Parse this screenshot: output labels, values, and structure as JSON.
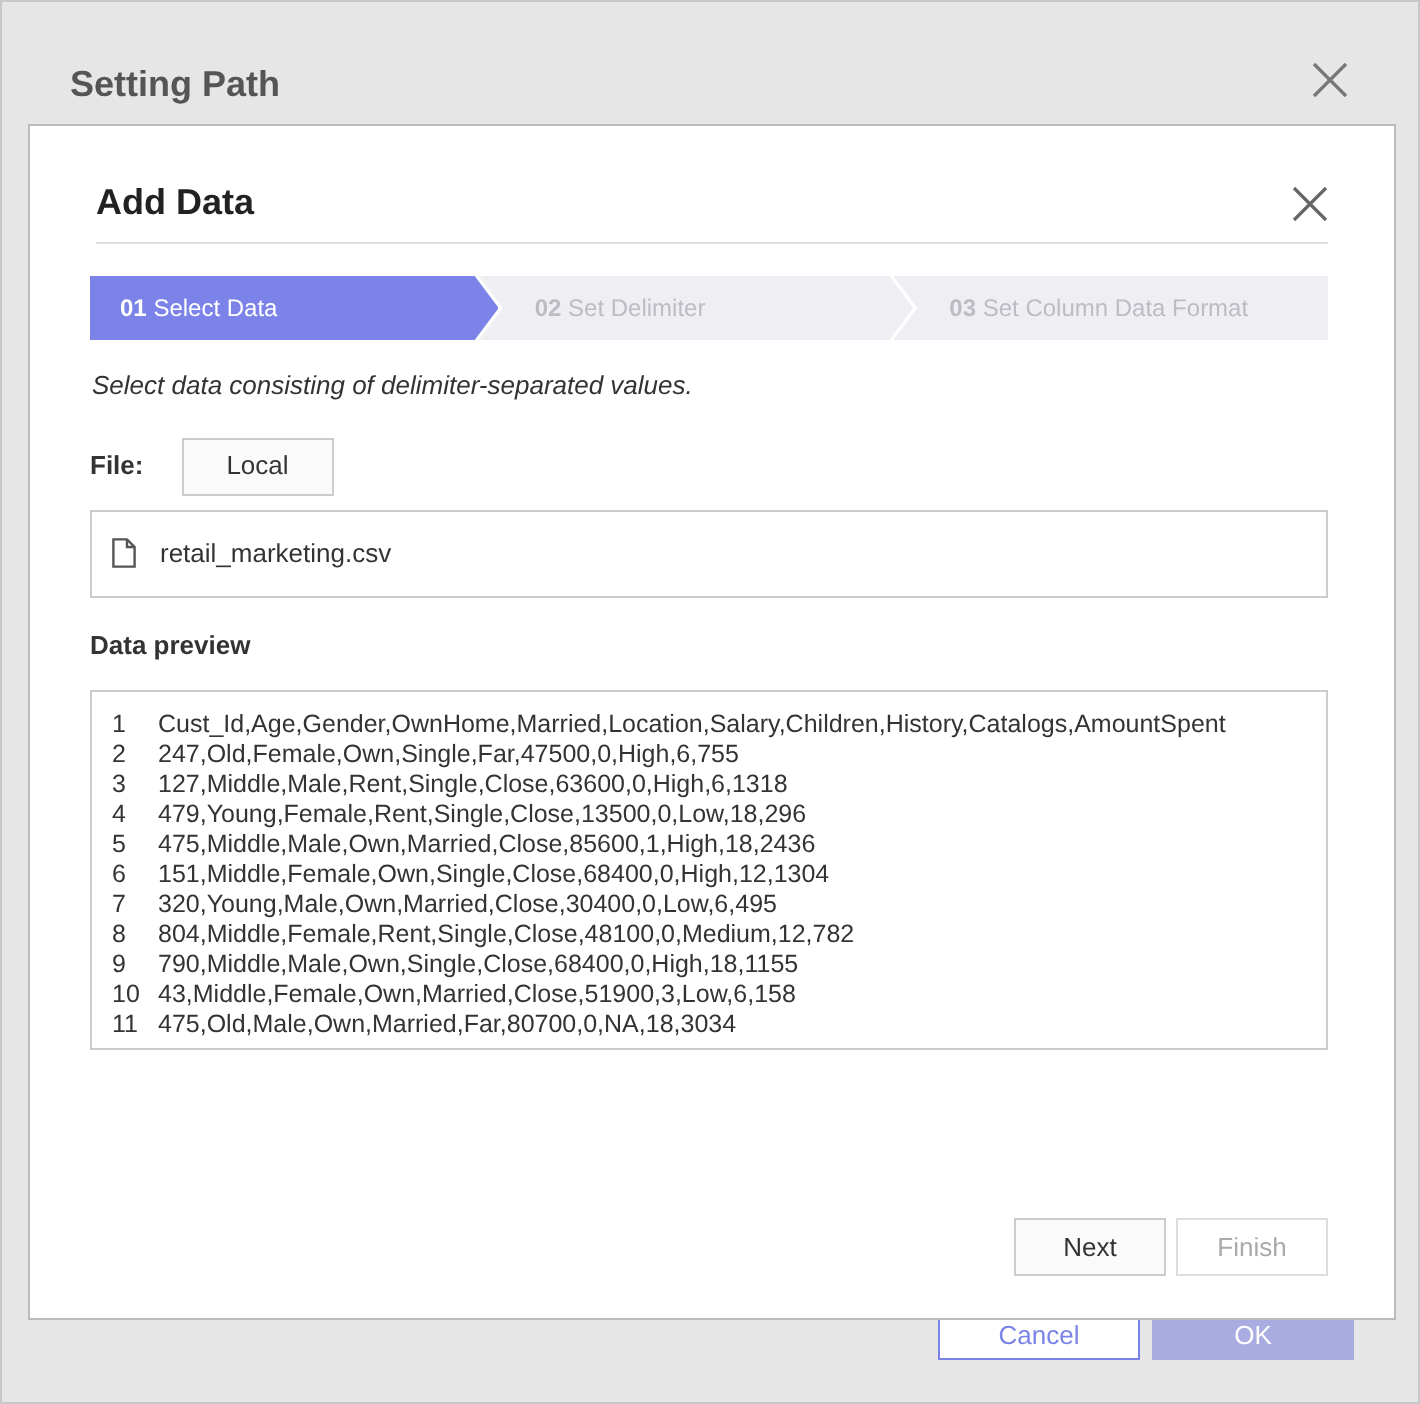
{
  "back_dialog": {
    "title": "Setting Path",
    "buttons": [
      {
        "label": "Cancel",
        "kind": "secondary"
      },
      {
        "label": "OK",
        "kind": "primary"
      }
    ]
  },
  "dialog": {
    "title": "Add Data",
    "steps": [
      {
        "label": "**01** Select Data",
        "selected": true
      },
      {
        "label": "**02** Set Delimiter",
        "selected": false
      },
      {
        "label": "**03** Set Column Data Format",
        "selected": false
      }
    ],
    "description": "Select data consisting of delimiter-separated values.",
    "file_label": "File:",
    "source_button": "Local",
    "file_name": "retail_marketing.csv",
    "preview_label": "Data preview",
    "preview_lines": [
      {
        "number": "1",
        "text": "Cust_Id,Age,Gender,OwnHome,Married,Location,Salary,Children,History,Catalogs,AmountSpent"
      },
      {
        "number": "2",
        "text": "247,Old,Female,Own,Single,Far,47500,0,High,6,755"
      },
      {
        "number": "3",
        "text": "127,Middle,Male,Rent,Single,Close,63600,0,High,6,1318"
      },
      {
        "number": "4",
        "text": "479,Young,Female,Rent,Single,Close,13500,0,Low,18,296"
      },
      {
        "number": "5",
        "text": "475,Middle,Male,Own,Married,Close,85600,1,High,18,2436"
      },
      {
        "number": "6",
        "text": "151,Middle,Female,Own,Single,Close,68400,0,High,12,1304"
      },
      {
        "number": "7",
        "text": "320,Young,Male,Own,Married,Close,30400,0,Low,6,495"
      },
      {
        "number": "8",
        "text": "804,Middle,Female,Rent,Single,Close,48100,0,Medium,12,782"
      },
      {
        "number": "9",
        "text": "790,Middle,Male,Own,Single,Close,68400,0,High,18,1155"
      },
      {
        "number": "10",
        "text": "43,Middle,Female,Own,Married,Close,51900,3,Low,6,158"
      },
      {
        "number": "11",
        "text": "475,Old,Male,Own,Married,Far,80700,0,NA,18,3034"
      }
    ],
    "buttons": [
      {
        "label": "Next",
        "disabled": false
      },
      {
        "label": "Finish",
        "disabled": true
      }
    ]
  }
}
